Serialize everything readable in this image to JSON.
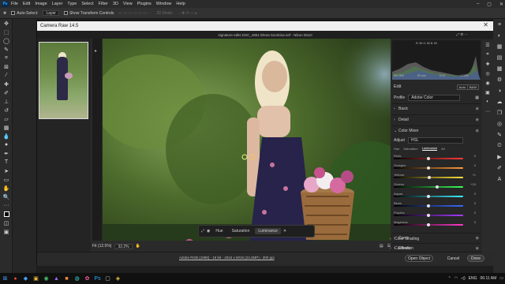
{
  "menubar": {
    "app_icon": "Ps",
    "items": [
      "File",
      "Edit",
      "Image",
      "Layer",
      "Type",
      "Select",
      "Filter",
      "3D",
      "View",
      "Plugins",
      "Window",
      "Help"
    ]
  },
  "options_bar": {
    "auto_select_label": "Auto-Select:",
    "auto_select_value": "Layer",
    "show_transform_label": "Show Transform Controls",
    "mode_3d_label": "3D Mode:"
  },
  "dialog": {
    "title": "Camera Raw 14.5",
    "file_header": "signature edits DSC_4861 Elena Sorokina.nef  -  Nikon D610",
    "fit_label": "Fit (12.5%)",
    "zoom_value": "32.2%",
    "workflow_link": "Adobe RGB (1998) - 16 bit - 4016 x 6016 (24.2MP) - 300 ppi",
    "buttons": {
      "open": "Open Object",
      "cancel": "Cancel",
      "done": "Done"
    }
  },
  "mask_tools": {
    "tabs": [
      "Hue",
      "Saturation",
      "Luminance"
    ],
    "active_tab": "Luminance"
  },
  "histogram": {
    "readout_top": "R: 80   G: 80   B: 80",
    "readout_bottom": [
      "ISO 800",
      "63 mm",
      "f/1.8",
      "1/200s"
    ]
  },
  "panel": {
    "edit_label": "Edit",
    "auto_label": "Auto",
    "bw_label": "B&W",
    "profile_label": "Profile",
    "profile_value": "Adobe Color",
    "sections": [
      {
        "label": "Basic"
      },
      {
        "label": "Detail"
      },
      {
        "label": "Color Mixer"
      },
      {
        "label": "Curve"
      },
      {
        "label": "Effects"
      },
      {
        "label": "Color Grading"
      },
      {
        "label": "Calibration"
      }
    ],
    "mixer": {
      "adjust_label": "Adjust",
      "adjust_value": "HSL",
      "tabs": [
        "Hue",
        "Saturation",
        "Luminance",
        "All"
      ],
      "active_tab": "Luminance",
      "sliders": [
        {
          "name": "Reds",
          "value": "0",
          "pos": 0.5
        },
        {
          "name": "Oranges",
          "value": "0",
          "pos": 0.5
        },
        {
          "name": "Yellows",
          "value": "+1",
          "pos": 0.51
        },
        {
          "name": "Greens",
          "value": "+24",
          "pos": 0.62
        },
        {
          "name": "Aquas",
          "value": "0",
          "pos": 0.5
        },
        {
          "name": "Blues",
          "value": "0",
          "pos": 0.5
        },
        {
          "name": "Purples",
          "value": "0",
          "pos": 0.5
        },
        {
          "name": "Magentas",
          "value": "0",
          "pos": 0.5
        }
      ]
    }
  },
  "tray": {
    "language": "ENG",
    "time": "06:11 AM"
  },
  "colors": {
    "accent": "#31a8ff",
    "panel_bg": "#272727",
    "title_bar": "#f0f0f0"
  }
}
